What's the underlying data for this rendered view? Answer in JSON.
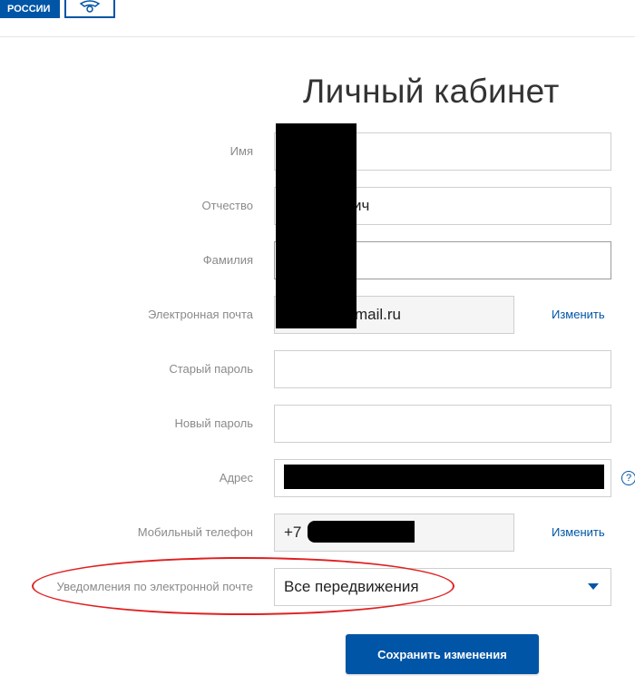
{
  "header": {
    "logo_text": "РОССИИ"
  },
  "page": {
    "title": "Личный кабинет"
  },
  "form": {
    "first_name": {
      "label": "Имя",
      "value": ""
    },
    "patronymic": {
      "label": "Отчество",
      "value": "ич"
    },
    "last_name": {
      "label": "Фамилия",
      "value": ""
    },
    "email": {
      "label": "Электронная почта",
      "value": "mail.ru",
      "change_link": "Изменить"
    },
    "old_password": {
      "label": "Старый пароль",
      "value": ""
    },
    "new_password": {
      "label": "Новый пароль",
      "value": ""
    },
    "address": {
      "label": "Адрес",
      "value": "",
      "help": "?"
    },
    "mobile_phone": {
      "label": "Мобильный телефон",
      "value": "+7",
      "change_link": "Изменить"
    },
    "email_notifications": {
      "label": "Уведомления по электронной почте",
      "selected": "Все передвижения"
    },
    "save_label": "Сохранить изменения"
  },
  "colors": {
    "accent": "#0055a6",
    "annotation": "#e02020",
    "redaction": "#000000"
  }
}
